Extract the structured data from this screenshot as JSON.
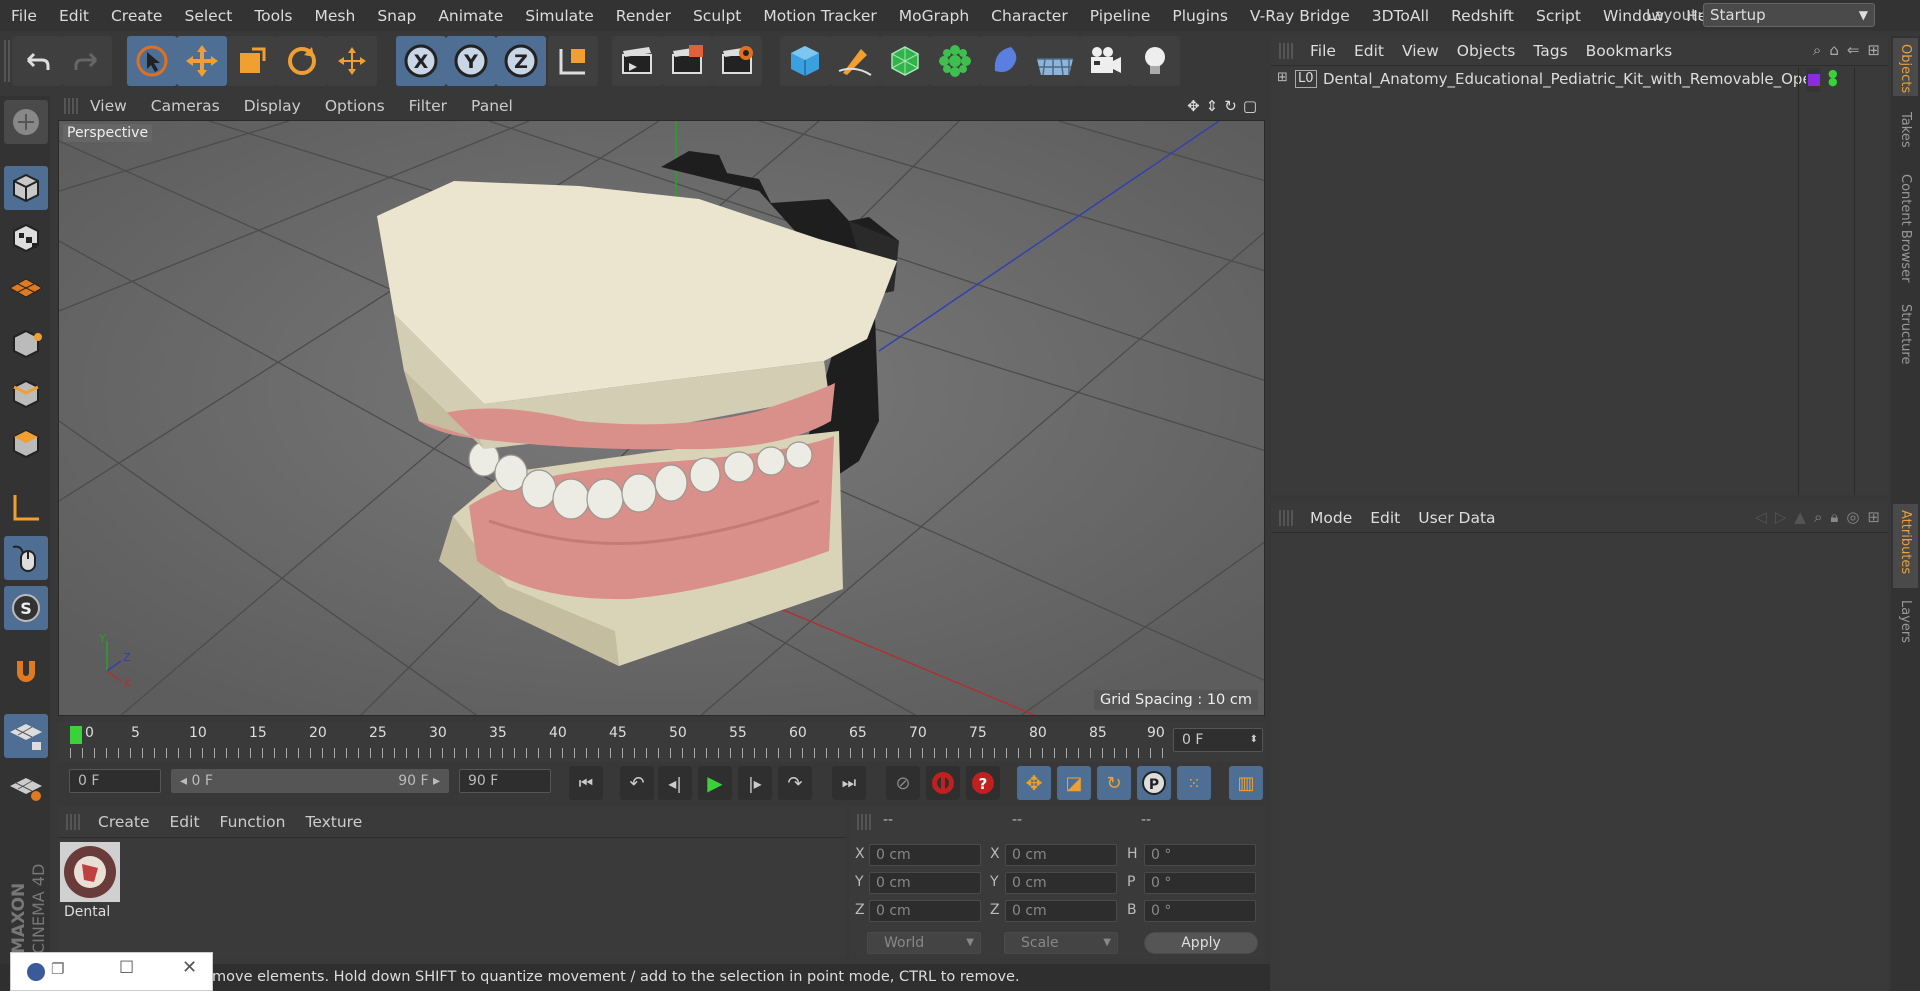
{
  "menubar": {
    "items": [
      "File",
      "Edit",
      "Create",
      "Select",
      "Tools",
      "Mesh",
      "Snap",
      "Animate",
      "Simulate",
      "Render",
      "Sculpt",
      "Motion Tracker",
      "MoGraph",
      "Character",
      "Pipeline",
      "Plugins",
      "V-Ray Bridge",
      "3DToAll",
      "Redshift",
      "Script",
      "Window",
      "Help"
    ],
    "layout_label": "Layout:",
    "layout_value": "Startup"
  },
  "toolbar": {
    "axis_x": "X",
    "axis_y": "Y",
    "axis_z": "Z"
  },
  "viewport": {
    "menu": [
      "View",
      "Cameras",
      "Display",
      "Options",
      "Filter",
      "Panel"
    ],
    "label": "Perspective",
    "grid_spacing": "Grid Spacing : 10 cm",
    "axis_x": "X",
    "axis_y": "Y",
    "axis_z": "Z"
  },
  "timeline": {
    "ticks": [
      "0",
      "5",
      "10",
      "15",
      "20",
      "25",
      "30",
      "35",
      "40",
      "45",
      "50",
      "55",
      "60",
      "65",
      "70",
      "75",
      "80",
      "85",
      "90"
    ],
    "current_frame": "0 F"
  },
  "transport": {
    "start_field": "0 F",
    "range_start": "0 F",
    "range_end": "90 F",
    "end_field": "90 F"
  },
  "materials": {
    "menu": [
      "Create",
      "Edit",
      "Function",
      "Texture"
    ],
    "items": [
      {
        "name": "Dental"
      }
    ]
  },
  "coordinates": {
    "headers": [
      "--",
      "--",
      "--"
    ],
    "position": {
      "x": "0 cm",
      "y": "0 cm",
      "z": "0 cm"
    },
    "size": {
      "x": "0 cm",
      "y": "0 cm",
      "z": "0 cm"
    },
    "rotation": {
      "h": "0 °",
      "p": "0 °",
      "b": "0 °"
    },
    "labels": {
      "x": "X",
      "y": "Y",
      "z": "Z",
      "h": "H",
      "p": "P",
      "b": "B"
    },
    "mode_world": "World",
    "mode_scale": "Scale",
    "apply": "Apply"
  },
  "status": {
    "text": "move elements. Hold down SHIFT to quantize movement / add to the selection in point mode, CTRL to remove."
  },
  "objects": {
    "menu": [
      "File",
      "Edit",
      "View",
      "Objects",
      "Tags",
      "Bookmarks"
    ],
    "tree": [
      {
        "name": "Dental_Anatomy_Educational_Pediatric_Kit_with_Removable_Ope",
        "layer_icon": "L0"
      }
    ]
  },
  "attributes": {
    "menu": [
      "Mode",
      "Edit",
      "User Data"
    ]
  },
  "side_tabs": [
    "Objects",
    "Takes",
    "Content Browser",
    "Structure",
    "Attributes",
    "Layers"
  ],
  "branding": {
    "logo_text": "MAXON CINEMA 4D"
  },
  "colors": {
    "accent_blue": "#4e6f93",
    "accent_orange": "#e6a040",
    "play_green": "#3bd13b"
  }
}
